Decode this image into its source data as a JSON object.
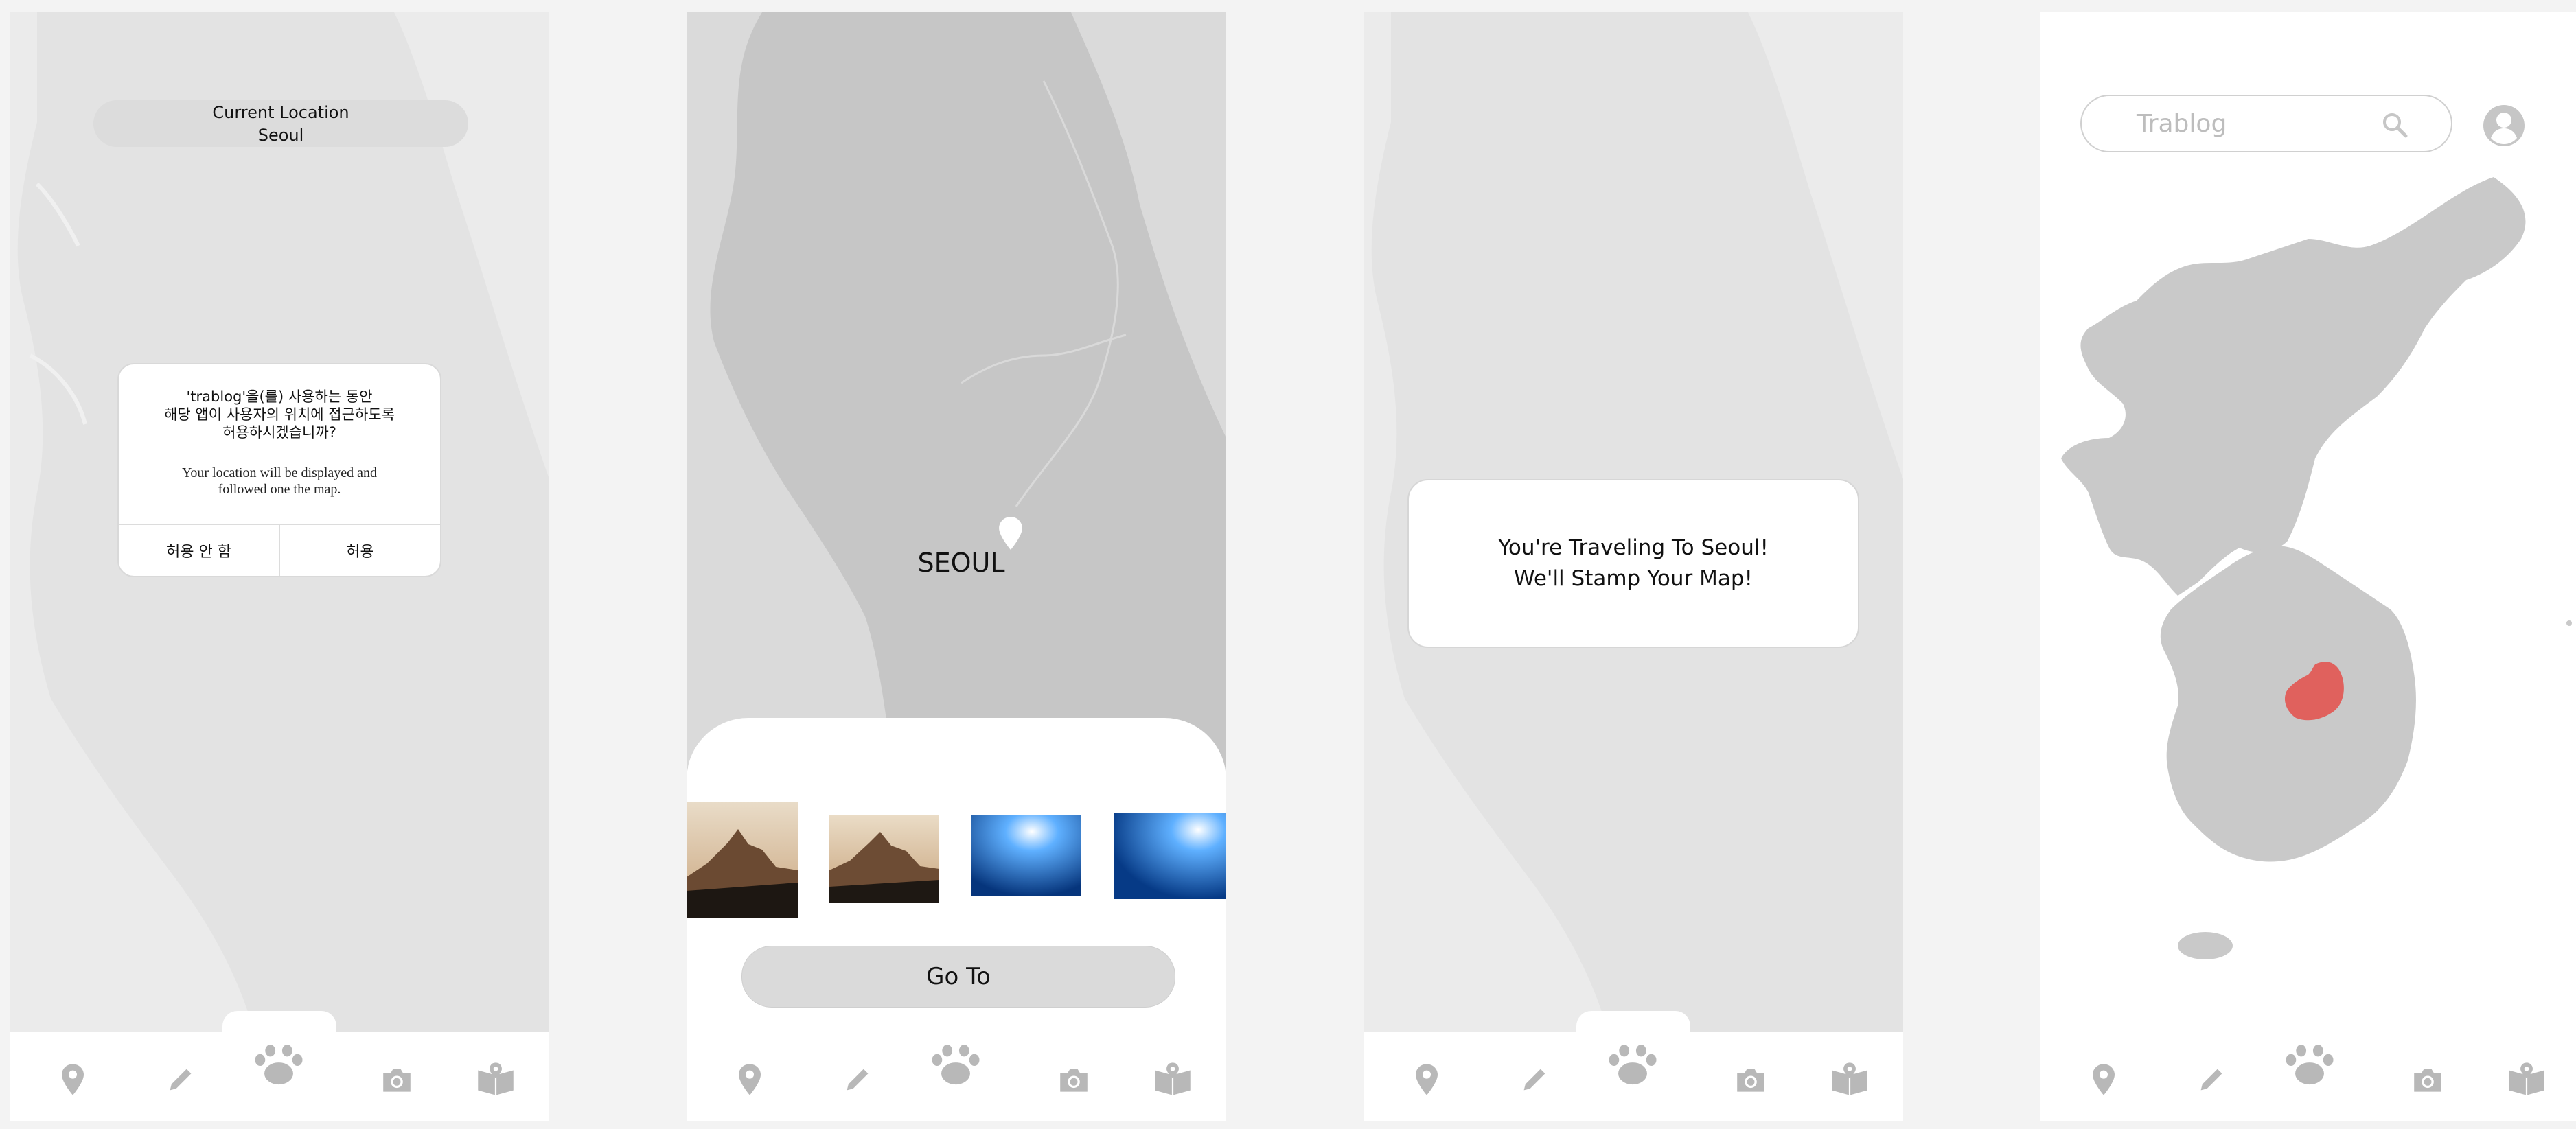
{
  "screens": [
    {
      "id": "permission",
      "location_pill": {
        "line1": "Current Location",
        "line2": "Seoul"
      },
      "dialog": {
        "korean_line1": "'trablog'을(를) 사용하는 동안",
        "korean_line2": "해당 앱이 사용자의 위치에 접근하도록",
        "korean_line3": "허용하시겠습니까?",
        "english_line1": "Your location will be displayed and",
        "english_line2": "followed one the map.",
        "deny_label": "허용 안 함",
        "allow_label": "허용"
      }
    },
    {
      "id": "destination",
      "pin_label": "SEOUL",
      "photos": [
        "mountain-photo",
        "mountain-photo",
        "ocean-photo",
        "ocean-photo"
      ],
      "go_button": "Go To"
    },
    {
      "id": "stamp",
      "toast_line1": "You're Traveling To Seoul!",
      "toast_line2": "We'll Stamp Your Map!"
    },
    {
      "id": "stamped-map",
      "search_placeholder": "Trablog",
      "highlight_region": "Seoul",
      "highlight_color": "#e0615d"
    }
  ],
  "tabbar": {
    "icons": [
      "location-pin-icon",
      "pencil-icon",
      "paw-icon",
      "camera-icon",
      "map-book-icon"
    ]
  },
  "colors": {
    "map_land": "#dcdcdc",
    "map_land_dark": "#bcbcbc",
    "icon_gray": "#b8b8b8",
    "stamp_red": "#e0615d"
  }
}
